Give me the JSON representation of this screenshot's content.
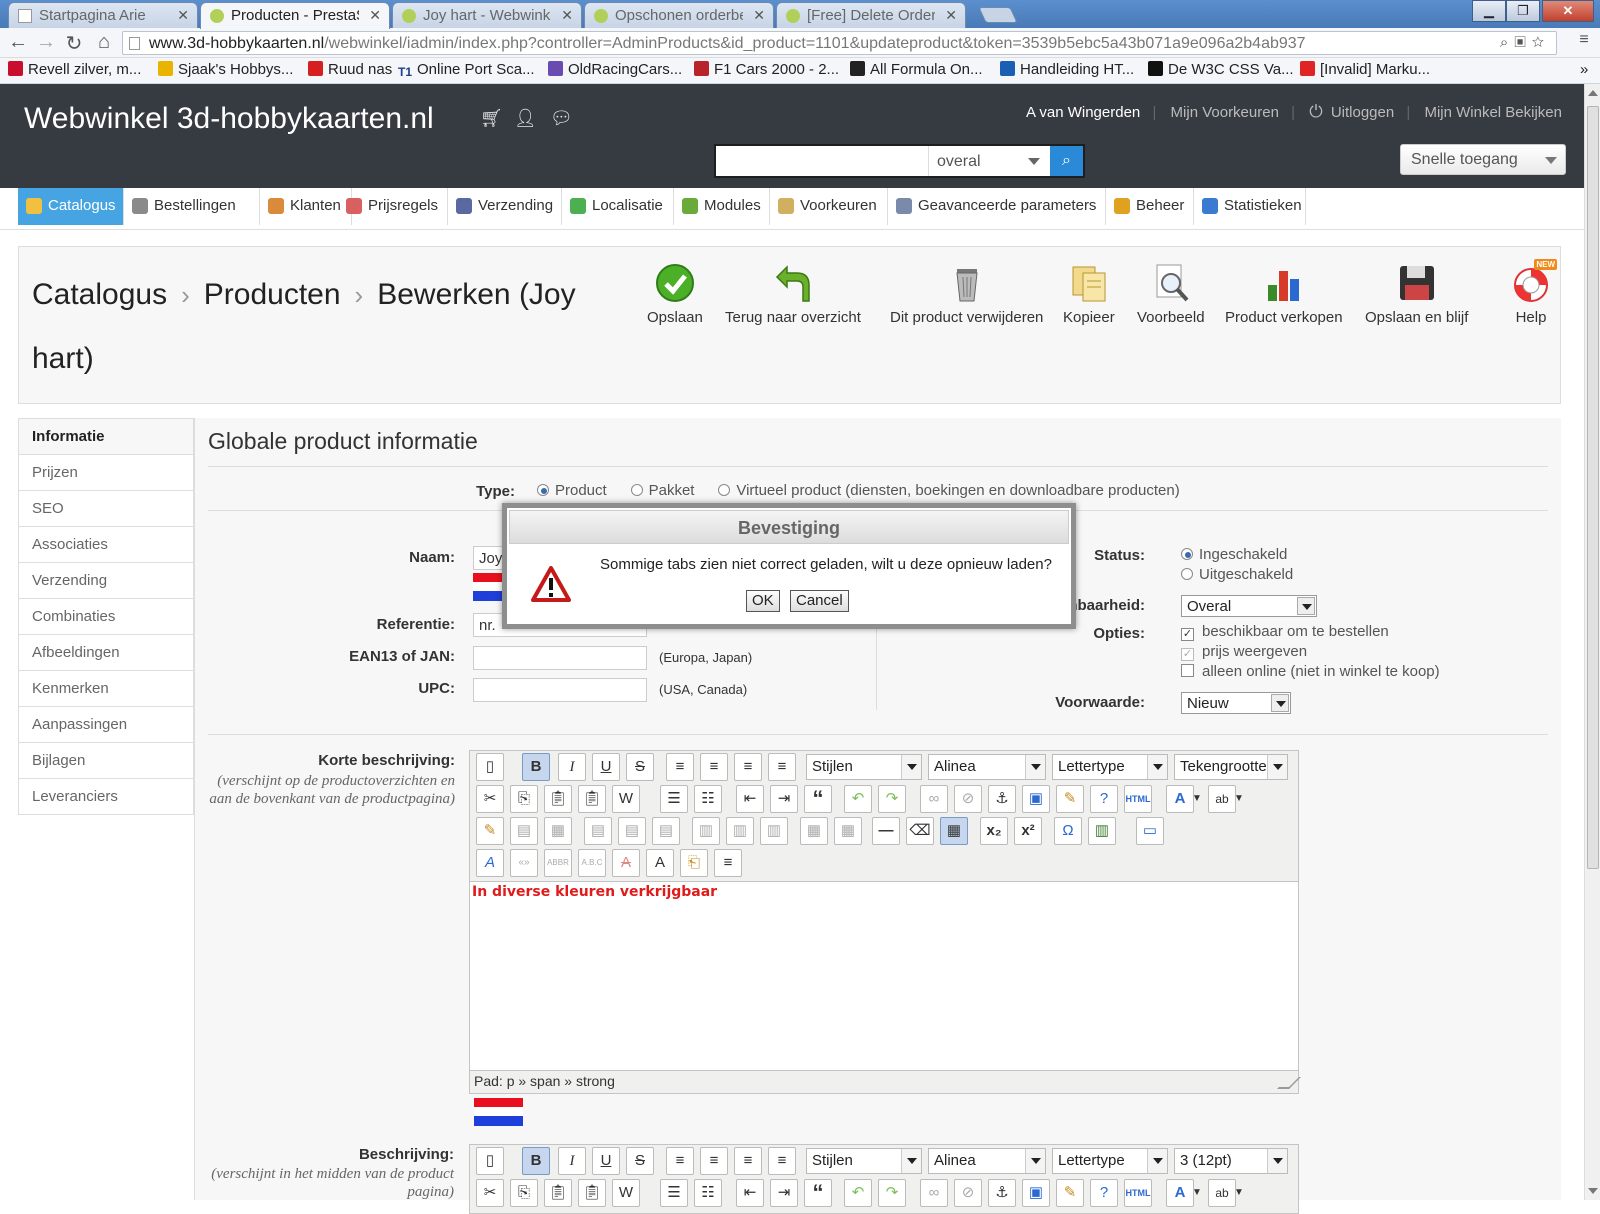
{
  "browser": {
    "tabs": [
      {
        "label": "Startpagina Arie"
      },
      {
        "label": "Producten - PrestaSh"
      },
      {
        "label": "Joy hart - Webwinkel"
      },
      {
        "label": "Opschonen orderbes"
      },
      {
        "label": "[Free] Delete Orders"
      }
    ],
    "url_host": "www.3d-hobbykaarten.nl",
    "url_path": "/webwinkel/iadmin/index.php?controller=AdminProducts&id_product=1101&updateproduct&token=3539b5ebc5a43b071a9e096a2b4ab937",
    "bookmarks": [
      {
        "label": "Revell zilver, m...",
        "color": "#c8102e"
      },
      {
        "label": "Sjaak's Hobbys...",
        "color": "#e8b400"
      },
      {
        "label": "Ruud nas",
        "color": "#d62020"
      },
      {
        "label": "Online Port Sca...",
        "prefix": "T1",
        "color": "#1a3e8a"
      },
      {
        "label": "OldRacingCars...",
        "color": "#6a4bb0"
      },
      {
        "label": "F1 Cars 2000 - 2...",
        "color": "#b8242a"
      },
      {
        "label": "All Formula On...",
        "color": "#222222"
      },
      {
        "label": "Handleiding HT...",
        "color": "#1b5fb4"
      },
      {
        "label": "De W3C CSS Va...",
        "color": "#111111"
      },
      {
        "label": "[Invalid] Marku...",
        "color": "#e02424"
      }
    ]
  },
  "header": {
    "shop_title": "Webwinkel 3d-hobbykaarten.nl",
    "user": "A van Wingerden",
    "preferences": "Mijn Voorkeuren",
    "logout": "Uitloggen",
    "view_shop": "Mijn Winkel Bekijken",
    "search_scope": "overal",
    "quick_access": "Snelle toegang"
  },
  "menu": [
    {
      "label": "Catalogus",
      "color": "#f0c040"
    },
    {
      "label": "Bestellingen",
      "color": "#8a8a8a"
    },
    {
      "label": "Klanten",
      "color": "#d98a3a"
    },
    {
      "label": "Prijsregels",
      "color": "#d96060"
    },
    {
      "label": "Verzending",
      "color": "#5a6aa0"
    },
    {
      "label": "Localisatie",
      "color": "#4caf50"
    },
    {
      "label": "Modules",
      "color": "#6aaa3a"
    },
    {
      "label": "Voorkeuren",
      "color": "#d0b060"
    },
    {
      "label": "Geavanceerde parameters",
      "color": "#7a8aaa"
    },
    {
      "label": "Beheer",
      "color": "#e0a020"
    },
    {
      "label": "Statistieken",
      "color": "#3a7ad0"
    }
  ],
  "breadcrumb": {
    "level1": "Catalogus",
    "level2": "Producten",
    "level3": "Bewerken (Joy hart)"
  },
  "actions": [
    {
      "label": "Opslaan",
      "icon": "check-icon"
    },
    {
      "label": "Terug naar overzicht",
      "icon": "back-arrow-icon"
    },
    {
      "label": "Dit product verwijderen",
      "icon": "trash-icon"
    },
    {
      "label": "Kopieer",
      "icon": "copy-icon"
    },
    {
      "label": "Voorbeeld",
      "icon": "preview-icon"
    },
    {
      "label": "Product verkopen",
      "icon": "bar-chart-icon"
    },
    {
      "label": "Opslaan en blijf",
      "icon": "floppy-icon"
    },
    {
      "label": "Help",
      "icon": "lifebuoy-icon",
      "badge": "NEW"
    }
  ],
  "side_tabs": [
    "Informatie",
    "Prijzen",
    "SEO",
    "Associaties",
    "Verzending",
    "Combinaties",
    "Afbeeldingen",
    "Kenmerken",
    "Aanpassingen",
    "Bijlagen",
    "Leveranciers"
  ],
  "form": {
    "section_title": "Globale product informatie",
    "type_label": "Type:",
    "type_options": [
      "Product",
      "Pakket",
      "Virtueel product (diensten, boekingen en downloadbare producten)"
    ],
    "name_label": "Naam:",
    "name_value": "Joy",
    "reference_label": "Referentie:",
    "reference_value": "nr.",
    "ean_label": "EAN13 of JAN:",
    "ean_hint": "(Europa, Japan)",
    "upc_label": "UPC:",
    "upc_hint": "(USA, Canada)",
    "status_label": "Status:",
    "status_options": [
      "Ingeschakeld",
      "Uitgeschakeld"
    ],
    "visibility_label": "ichbaarheid:",
    "visibility_value": "Overal",
    "options_label": "Opties:",
    "options": [
      "beschikbaar om te bestellen",
      "prijs weergeven",
      "alleen online (niet in winkel te koop)"
    ],
    "condition_label": "Voorwaarde:",
    "condition_value": "Nieuw",
    "short_desc_label": "Korte beschrijving:",
    "short_desc_hint": "(verschijnt op de productoverzichten en aan de bovenkant van de productpagina)",
    "short_desc_text": "In diverse kleuren verkrijgbaar",
    "editor_path": "Pad: p » span » strong",
    "desc_label": "Beschrijving:",
    "desc_hint": "(verschijnt in het midden van de product pagina)"
  },
  "editor": {
    "styles": "Stijlen",
    "format": "Alinea",
    "font": "Lettertype",
    "size_short": "Tekengrootte",
    "size_desc": "3 (12pt)"
  },
  "modal": {
    "title": "Bevestiging",
    "message": "Sommige tabs zien niet correct geladen, wilt u deze opnieuw laden?",
    "ok": "OK",
    "cancel": "Cancel"
  }
}
